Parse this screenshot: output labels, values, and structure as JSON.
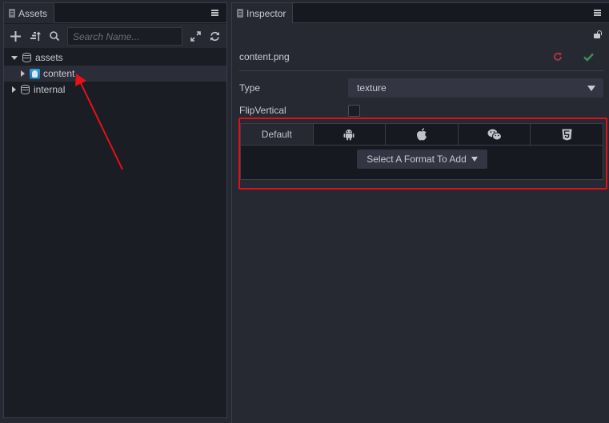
{
  "assets_panel": {
    "tab_label": "Assets",
    "tab_icon": "clipboard-icon",
    "menu_icon": "hamburger-menu-icon",
    "toolbar": {
      "add_icon": "plus-icon",
      "sort_icon": "sort-icon",
      "search_icon": "search-icon",
      "search_placeholder": "Search Name...",
      "search_value": "",
      "expand_icon": "expand-icon",
      "refresh_icon": "refresh-icon"
    },
    "tree": [
      {
        "label": "assets",
        "icon": "database-icon",
        "expanded": true,
        "level": 0
      },
      {
        "label": "content",
        "icon": "image-file-icon",
        "expanded": false,
        "level": 1,
        "selected": true
      },
      {
        "label": "internal",
        "icon": "database-icon",
        "expanded": false,
        "level": 0
      }
    ]
  },
  "inspector_panel": {
    "tab_label": "Inspector",
    "tab_icon": "clipboard-icon",
    "menu_icon": "hamburger-menu-icon",
    "lock_icon": "unlocked-icon",
    "file_name": "content.png",
    "revert_icon": "revert-icon",
    "apply_icon": "check-icon",
    "properties": {
      "type_label": "Type",
      "type_value": "texture",
      "flip_label": "FlipVertical",
      "flip_checked": false
    },
    "platform_tabs": [
      {
        "label": "Default",
        "icon": "",
        "active": true
      },
      {
        "label": "",
        "icon": "android-icon",
        "active": false
      },
      {
        "label": "",
        "icon": "apple-icon",
        "active": false
      },
      {
        "label": "",
        "icon": "wechat-icon",
        "active": false
      },
      {
        "label": "",
        "icon": "html5-icon",
        "active": false
      }
    ],
    "format_button": "Select A Format To Add"
  },
  "annotations": {
    "highlight_color": "#e0101a",
    "arrow_color": "#e8101a"
  }
}
